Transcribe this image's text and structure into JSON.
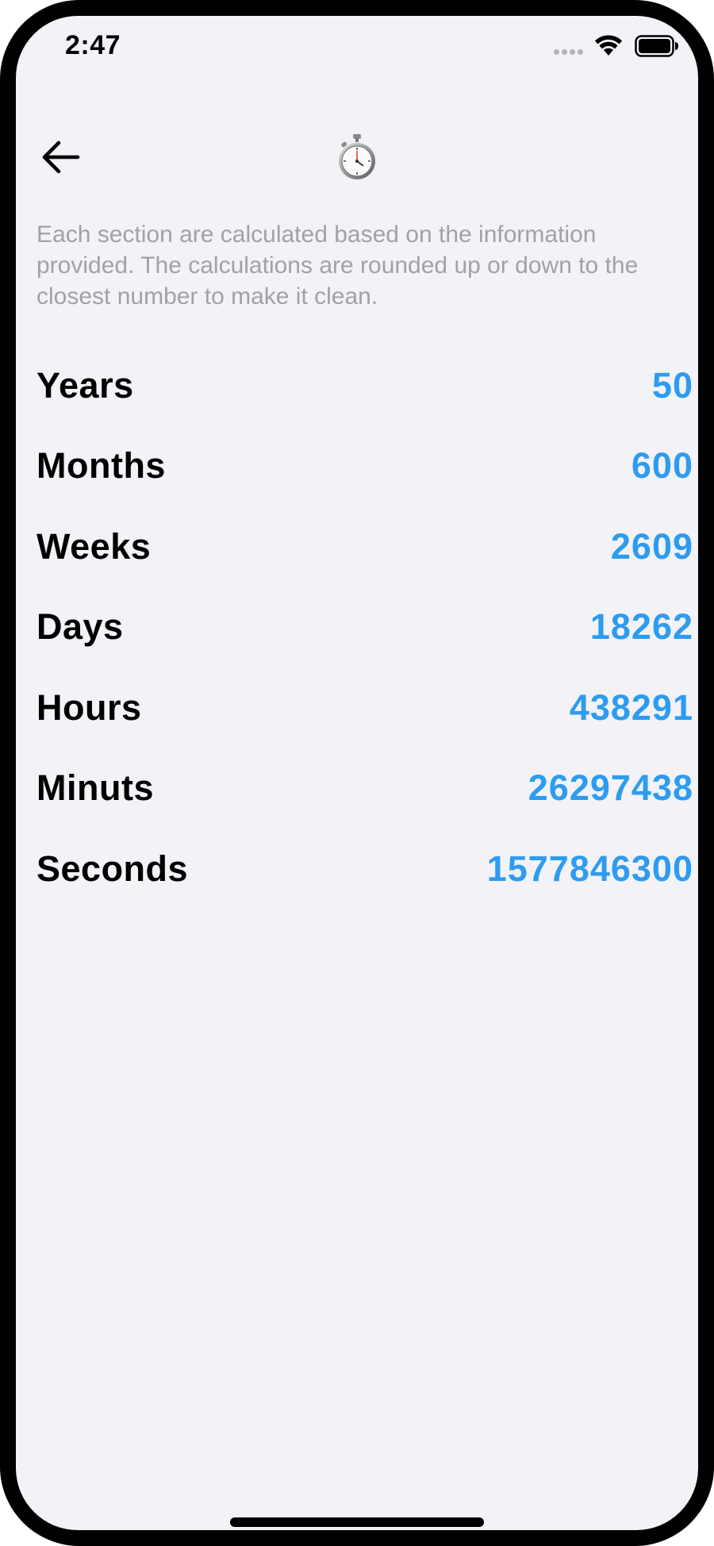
{
  "status_bar": {
    "time": "2:47"
  },
  "nav": {
    "back_icon": "arrow-left-icon",
    "title_icon": "stopwatch-icon"
  },
  "description": "Each section are calculated based on the information provided. The calculations are rounded up or down to the closest number to make it clean.",
  "rows": [
    {
      "label": "Years",
      "value": "50"
    },
    {
      "label": "Months",
      "value": "600"
    },
    {
      "label": "Weeks",
      "value": "2609"
    },
    {
      "label": "Days",
      "value": "18262"
    },
    {
      "label": "Hours",
      "value": "438291"
    },
    {
      "label": "Minuts",
      "value": "26297438"
    },
    {
      "label": "Seconds",
      "value": "1577846300"
    }
  ],
  "colors": {
    "background": "#f2f2f7",
    "value_accent": "#2d9cf0",
    "description_text": "#a1a1a6"
  }
}
